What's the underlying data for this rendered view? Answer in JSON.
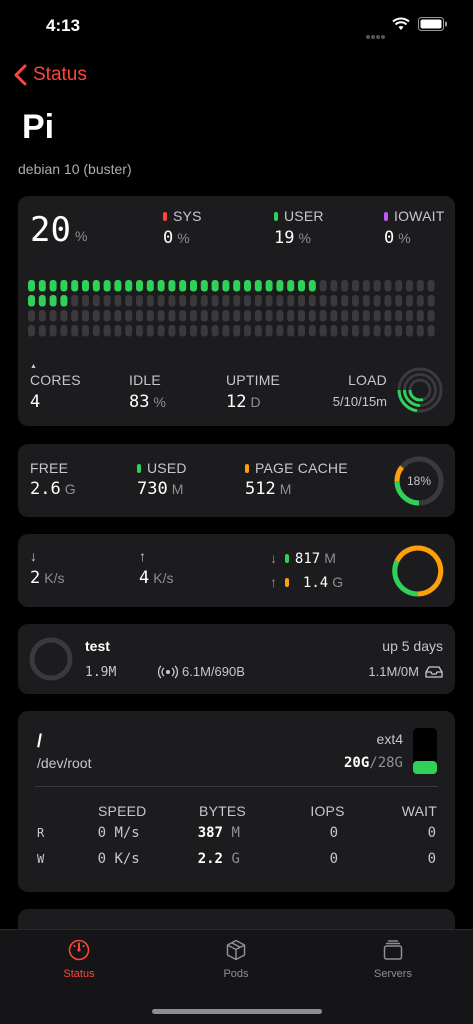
{
  "status_bar": {
    "time": "4:13"
  },
  "nav": {
    "back_label": "Status"
  },
  "header": {
    "title": "Pi",
    "subtitle": "debian 10 (buster)"
  },
  "cpu": {
    "total_value": "20",
    "total_unit": "%",
    "sys_label": "SYS",
    "sys_value": "0",
    "sys_unit": "%",
    "user_label": "USER",
    "user_value": "19",
    "user_unit": "%",
    "iowait_label": "IOWAIT",
    "iowait_value": "0",
    "iowait_unit": "%",
    "cores_label": "CORES",
    "cores_value": "4",
    "idle_label": "IDLE",
    "idle_value": "83",
    "idle_unit": "%",
    "uptime_label": "UPTIME",
    "uptime_value": "12",
    "uptime_unit": "D",
    "load_label": "LOAD",
    "load_value": "5/10/15m",
    "bars_row1_active": 27,
    "bars_row2_active": 4,
    "bars_total": 38,
    "colors": {
      "sys": "#ff453a",
      "user": "#30d158",
      "iowait": "#bf5af2",
      "bar_off": "#3a3a3c"
    }
  },
  "memory": {
    "free_label": "FREE",
    "free_value": "2.6",
    "free_unit": "G",
    "used_label": "USED",
    "used_value": "730",
    "used_unit": "M",
    "cache_label": "PAGE CACHE",
    "cache_value": "512",
    "cache_unit": "M",
    "ring_label": "18%",
    "colors": {
      "used": "#30d158",
      "cache": "#ff9f0a"
    }
  },
  "network": {
    "down_arrow": "↓",
    "down_value": "2",
    "down_unit": "K/s",
    "up_arrow": "↑",
    "up_value": "4",
    "up_unit": "K/s",
    "total_down_value": "817",
    "total_down_unit": "M",
    "total_up_value": "1.4",
    "total_up_unit": "G"
  },
  "container": {
    "name": "test",
    "uptime": "up 5 days",
    "memory": "1.9M",
    "net": "6.1M/690B",
    "disk": "1.1M/0M"
  },
  "disk": {
    "mount": "/",
    "device": "/dev/root",
    "fs": "ext4",
    "used_value": "20G",
    "total_value": "28G",
    "cols": [
      "SPEED",
      "BYTES",
      "IOPS",
      "WAIT"
    ],
    "rows": [
      {
        "label": "R",
        "speed": "0",
        "speed_unit": "M/s",
        "bytes": "387",
        "bytes_unit": "M",
        "iops": "0",
        "wait": "0"
      },
      {
        "label": "W",
        "speed": "0",
        "speed_unit": "K/s",
        "bytes": "2.2",
        "bytes_unit": "G",
        "iops": "0",
        "wait": "0"
      }
    ]
  },
  "tabs": [
    {
      "label": "Status",
      "active": true
    },
    {
      "label": "Pods",
      "active": false
    },
    {
      "label": "Servers",
      "active": false
    }
  ],
  "accent": "#ff453a"
}
